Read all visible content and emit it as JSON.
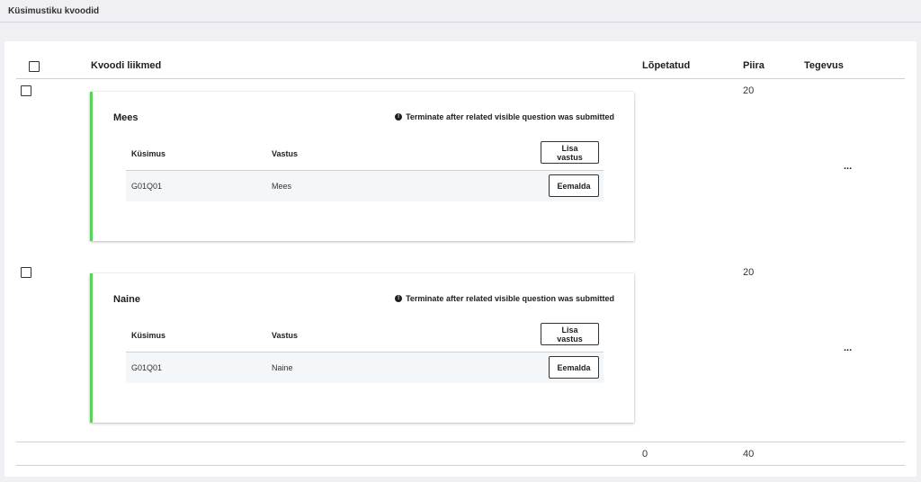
{
  "page": {
    "title": "Küsimustiku kvoodid"
  },
  "table": {
    "headers": {
      "members": "Kvoodi liikmed",
      "completed": "Lõpetatud",
      "limit": "Piira",
      "actions": "Tegevus"
    },
    "rows": [
      {
        "limit": "20",
        "actions_label": "...",
        "card": {
          "title": "Mees",
          "note": "Terminate after related visible question was submitted",
          "col_question": "Küsimus",
          "col_answer": "Vastus",
          "add_answer_label": "Lisa vastus",
          "items": [
            {
              "question": "G01Q01",
              "answer": "Mees",
              "remove_label": "Eemalda"
            }
          ]
        }
      },
      {
        "limit": "20",
        "actions_label": "...",
        "card": {
          "title": "Naine",
          "note": "Terminate after related visible question was submitted",
          "col_question": "Küsimus",
          "col_answer": "Vastus",
          "add_answer_label": "Lisa vastus",
          "items": [
            {
              "question": "G01Q01",
              "answer": "Naine",
              "remove_label": "Eemalda"
            }
          ]
        }
      }
    ],
    "totals": {
      "completed": "0",
      "limit": "40"
    }
  },
  "colors": {
    "accent": "#5bd35b",
    "row_bg": "#f3f7fa",
    "page_bg": "#f0f0f4"
  }
}
